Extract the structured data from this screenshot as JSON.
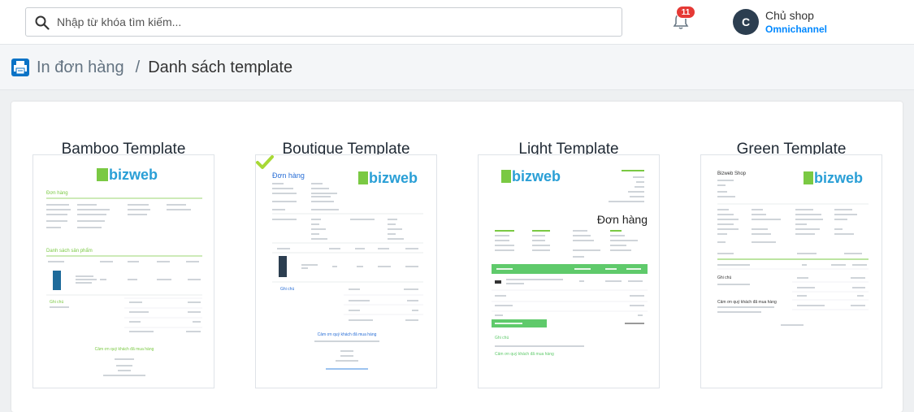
{
  "search": {
    "placeholder": "Nhập từ khóa tìm kiếm..."
  },
  "notifications": {
    "count": "11"
  },
  "user": {
    "initial": "C",
    "name": "Chủ shop",
    "subtitle": "Omnichannel"
  },
  "breadcrumb": {
    "parent": "In đơn hàng",
    "separator": "/",
    "current": "Danh sách template"
  },
  "templates": [
    {
      "title": "Bamboo Template",
      "selected": false
    },
    {
      "title": "Boutique Template",
      "selected": true
    },
    {
      "title": "Light Template",
      "selected": false
    },
    {
      "title": "Green Template",
      "selected": false
    }
  ],
  "thumbs": {
    "logo": "bizweb",
    "order_heading": "Đơn hàng",
    "product_list": "Danh sách sản phẩm",
    "notes": "Ghi chú",
    "thanks": "Cảm ơn quý khách đã mua hàng",
    "shop": "Bizweb Shop"
  },
  "colors": {
    "accent": "#0088ff",
    "brand_green": "#7ac943",
    "brand_blue": "#2a9fd6",
    "check_green": "#a8d936"
  },
  "icons": {
    "search": "search-icon",
    "bell": "bell-icon",
    "print": "printer-icon",
    "check": "check-icon"
  }
}
